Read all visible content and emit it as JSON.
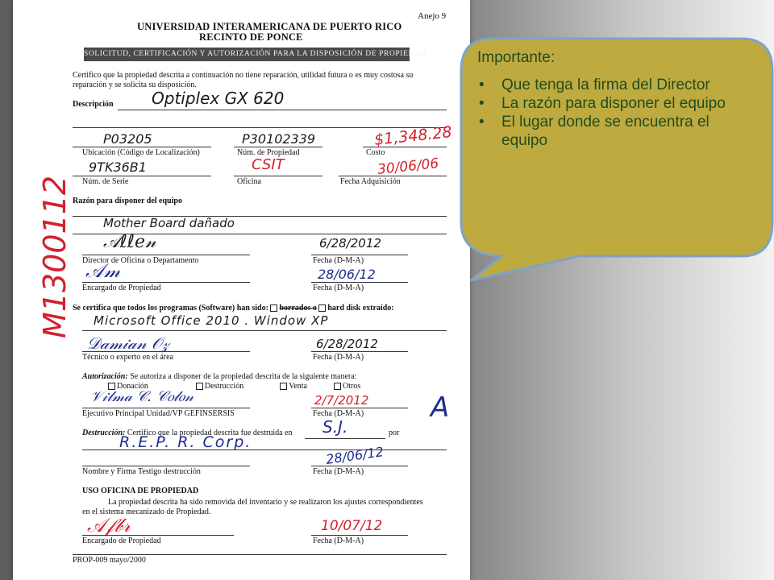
{
  "document": {
    "annex": "Anejo 9",
    "university": "UNIVERSIDAD INTERAMERICANA DE PUERTO RICO",
    "campus": "RECINTO DE PONCE",
    "form_title": "SOLICITUD, CERTIFICACIÓN Y AUTORIZACIÓN PARA LA DISPOSICIÓN DE PROPIEDAD",
    "intro_line1": "Certifico que la propiedad descrita a continuación no tiene reparación, utilidad futura o es muy costosa su",
    "intro_line2": "reparación y se solicita su disposición.",
    "description_label": "Descripción",
    "description_value": "Optiplex GX 620",
    "location_value": "P03205",
    "location_label": "Ubicación (Código de Localización)",
    "property_number_value": "P30102339",
    "property_number_label": "Núm. de Propiedad",
    "cost_value": "$1,348.28",
    "cost_label": "Costo",
    "serial_value": "9TK36B1",
    "serial_label": "Núm. de Serie",
    "office_value": "CSIT",
    "office_label": "Oficina",
    "acquisition_date_value": "30/06/06",
    "acquisition_date_label": "Fecha Adquisición",
    "reason_label": "Razón para disponer del equipo",
    "reason_value": "Mother Board dañado",
    "director_label": "Director de Oficina o Departamento",
    "director_date_value": "6/28/2012",
    "date_label": "Fecha (D-M-A)",
    "property_officer_label": "Encargado de Propiedad",
    "property_officer_date_value": "28/06/12",
    "software_label": "Se certifica que todos los programas (Software) han sido:",
    "software_opt1": "borrados o",
    "software_opt2": "hard disk extraído:",
    "software_value": "Microsoft Office 2010 . Window XP",
    "technician_label": "Técnico o experto en el área",
    "technician_date_value": "6/28/2012",
    "authorization_label": "Autorización:",
    "authorization_text": "Se autoriza a disponer de la propiedad descrita de la siguiente manera:",
    "option_donation": "Donación",
    "option_destruction": "Destrucción",
    "option_sale": "Venta",
    "option_other": "Otros",
    "executive_label": "Ejecutivo Principal Unidad/VP GEFINSERSIS",
    "executive_date_value": "2/7/2012",
    "destruction_label": "Destrucción:",
    "destruction_text": "Certifico que la propiedad descrita fue destruida en",
    "destruction_place": "S.J.",
    "destruction_by": "por",
    "destruction_company": "R.E.P. R. Corp.",
    "witness_label": "Nombre y Firma Testigo destrucción",
    "witness_date_value": "28/06/12",
    "office_use_label": "USO OFICINA DE PROPIEDAD",
    "office_use_line1": "La propiedad descrita ha sido removida del inventario y se realizaron los ajustes correspondientes",
    "office_use_line2": "en el sistema mecanizado de Propiedad.",
    "final_date_value": "10/07/12",
    "form_code": "PROP-009 mayo/2000",
    "side_number": "M1300112",
    "margin_mark": "A"
  },
  "callout": {
    "title": "Importante:",
    "items": [
      "Que tenga la firma del Director",
      "La razón para disponer el equipo",
      "El lugar donde se encuentra el equipo"
    ],
    "fill_color": "#bfaa3f",
    "border_color": "#7fa3c6",
    "text_color": "#1f4d1f"
  }
}
